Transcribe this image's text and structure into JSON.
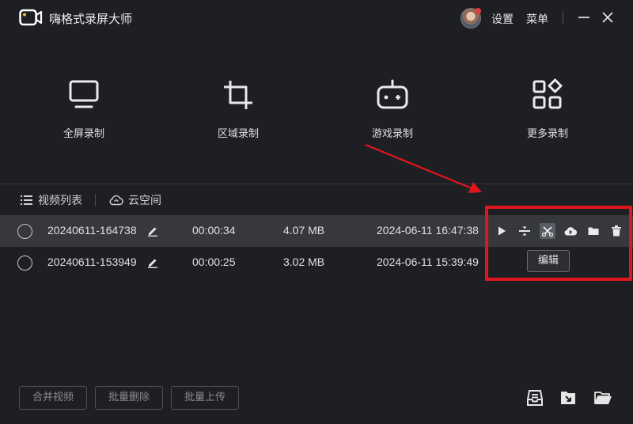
{
  "app": {
    "title": "嗨格式录屏大师"
  },
  "titlebar": {
    "settings_label": "设置",
    "menu_label": "菜单"
  },
  "modes": [
    {
      "label": "全屏录制",
      "icon": "monitor-icon"
    },
    {
      "label": "区域录制",
      "icon": "crop-icon"
    },
    {
      "label": "游戏录制",
      "icon": "gamepad-icon"
    },
    {
      "label": "更多录制",
      "icon": "grid-more-icon"
    }
  ],
  "list_tabs": {
    "video_list_label": "视频列表",
    "cloud_label": "云空间"
  },
  "recordings": [
    {
      "name": "20240611-164738",
      "duration": "00:00:34",
      "size": "4.07 MB",
      "date": "2024-06-11 16:47:38",
      "selected": true
    },
    {
      "name": "20240611-153949",
      "duration": "00:00:25",
      "size": "3.02 MB",
      "date": "2024-06-11 15:39:49",
      "selected": false
    }
  ],
  "row_actions": [
    "play-icon",
    "split-icon",
    "edit-icon",
    "upload-cloud-icon",
    "folder-icon",
    "delete-icon"
  ],
  "tooltip": {
    "text": "编辑"
  },
  "bottom_bar": {
    "merge_label": "合并视频",
    "batch_delete_label": "批量删除",
    "batch_upload_label": "批量上传"
  },
  "colors": {
    "background": "#1e1f23",
    "selected_row": "#36383e",
    "annotation": "#e0161e"
  }
}
